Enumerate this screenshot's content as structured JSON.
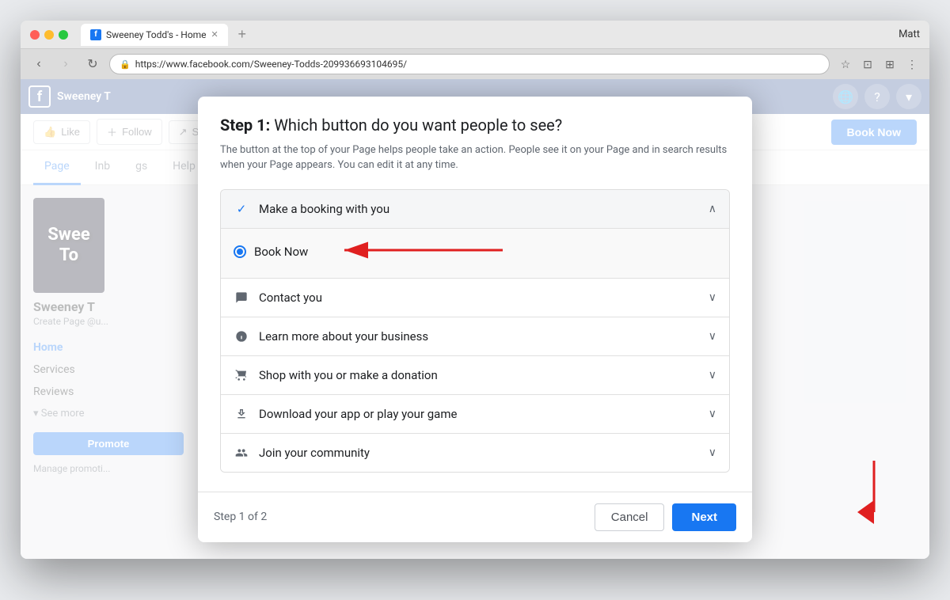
{
  "window": {
    "title": "Sweeney Todd's - Home",
    "user": "Matt"
  },
  "browser": {
    "url": "https://www.facebook.com/Sweeney-Todds-209936693104695/",
    "secure_label": "Secure"
  },
  "facebook": {
    "logo": "f",
    "page_name": "Sweeney T",
    "page_sub": "Create Page @u...",
    "action_buttons": {
      "like": "Like",
      "follow": "Follow",
      "share": "Share",
      "more": "···",
      "book_now": "Book Now"
    },
    "tabs": [
      "Page",
      "Inb",
      "gs",
      "Help ▾"
    ],
    "sidebar_nav": [
      "Home",
      "Services",
      "Reviews",
      "See more"
    ],
    "promote_label": "Promote",
    "manage_promotions": "Manage promoti..."
  },
  "modal": {
    "step_label": "Step 1:",
    "step_title": "Which button do you want people to see?",
    "description": "The button at the top of your Page helps people take an action. People see it on your Page and in search results when your Page appears. You can edit it at any time.",
    "options": [
      {
        "id": "make-booking",
        "icon": "✓",
        "icon_type": "check",
        "label": "Make a booking with you",
        "expanded": true,
        "sub_options": [
          {
            "id": "book-now",
            "label": "Book Now",
            "selected": true
          }
        ]
      },
      {
        "id": "contact-you",
        "icon": "💬",
        "icon_type": "chat",
        "label": "Contact you",
        "expanded": false
      },
      {
        "id": "learn-more",
        "icon": "ℹ",
        "icon_type": "info",
        "label": "Learn more about your business",
        "expanded": false
      },
      {
        "id": "shop",
        "icon": "🛒",
        "icon_type": "shop",
        "label": "Shop with you or make a donation",
        "expanded": false
      },
      {
        "id": "download",
        "icon": "⬇",
        "icon_type": "download",
        "label": "Download your app or play your game",
        "expanded": false
      },
      {
        "id": "community",
        "icon": "👥",
        "icon_type": "people",
        "label": "Join your community",
        "expanded": false
      }
    ],
    "footer": {
      "step_indicator": "Step 1 of 2",
      "cancel": "Cancel",
      "next": "Next"
    }
  }
}
